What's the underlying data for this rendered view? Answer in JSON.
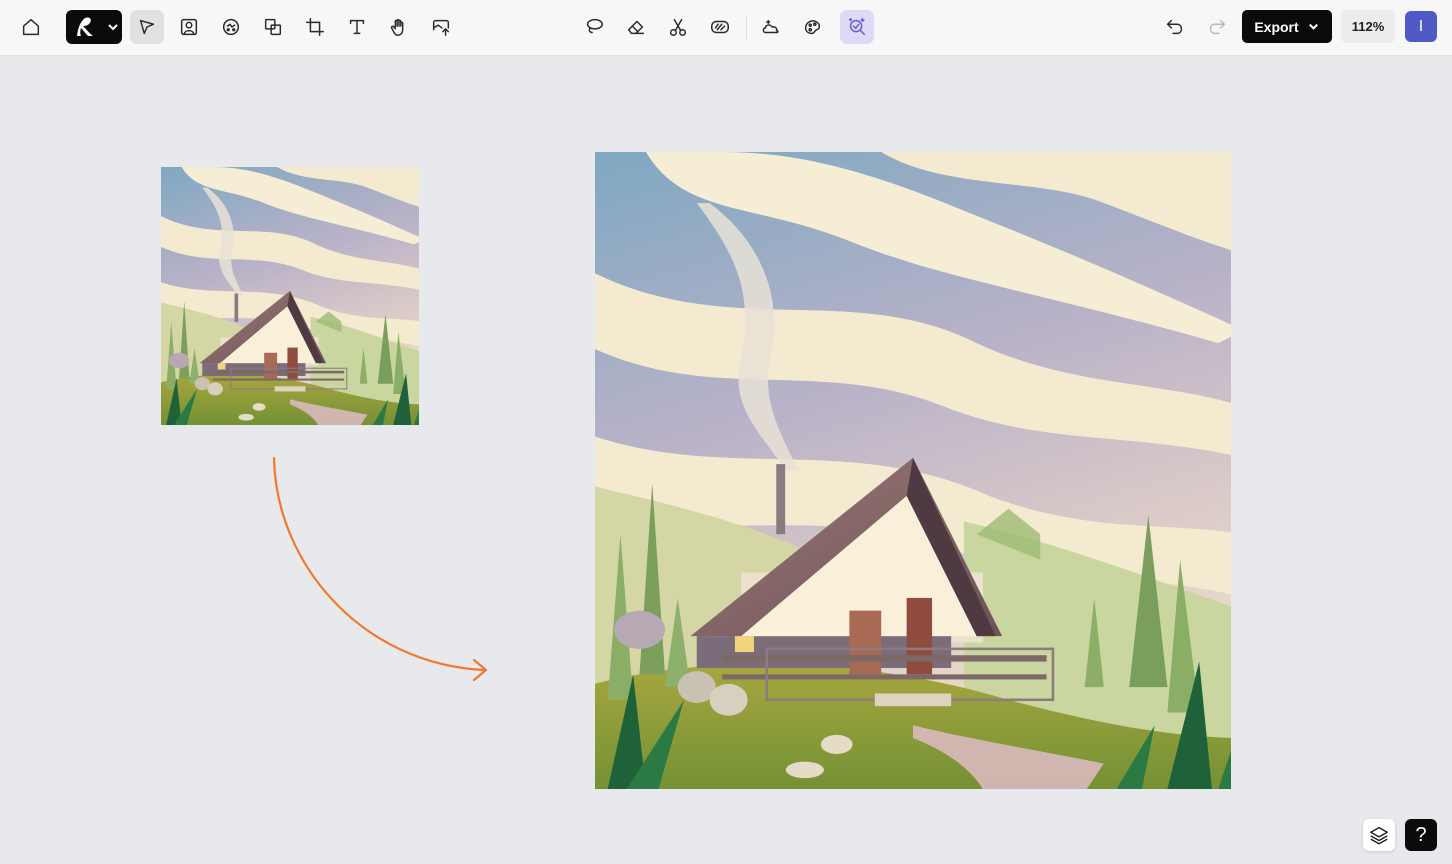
{
  "toolbar": {
    "left_tools": [
      {
        "name": "home-icon"
      },
      {
        "name": "select-arrow-icon"
      },
      {
        "name": "image-frame-icon"
      },
      {
        "name": "generate-icon"
      },
      {
        "name": "layers-combine-icon"
      },
      {
        "name": "crop-icon"
      },
      {
        "name": "text-icon"
      },
      {
        "name": "hand-icon"
      },
      {
        "name": "upload-icon"
      }
    ],
    "center_tools": [
      {
        "name": "lasso-icon"
      },
      {
        "name": "eraser-icon"
      },
      {
        "name": "scissors-icon"
      },
      {
        "name": "remove-background-icon"
      },
      {
        "name": "cloud-enhance-icon"
      },
      {
        "name": "style-transfer-icon"
      },
      {
        "name": "upscale-icon"
      }
    ],
    "undo_icon": "undo-icon",
    "redo_icon": "redo-icon",
    "export_label": "Export",
    "zoom_label": "112%",
    "avatar_initial": "I"
  },
  "colors": {
    "accent": "#6360c9",
    "avatar": "#4f5ac4",
    "arrow": "#ef7a2d"
  },
  "footer": {
    "help_label": "?"
  }
}
